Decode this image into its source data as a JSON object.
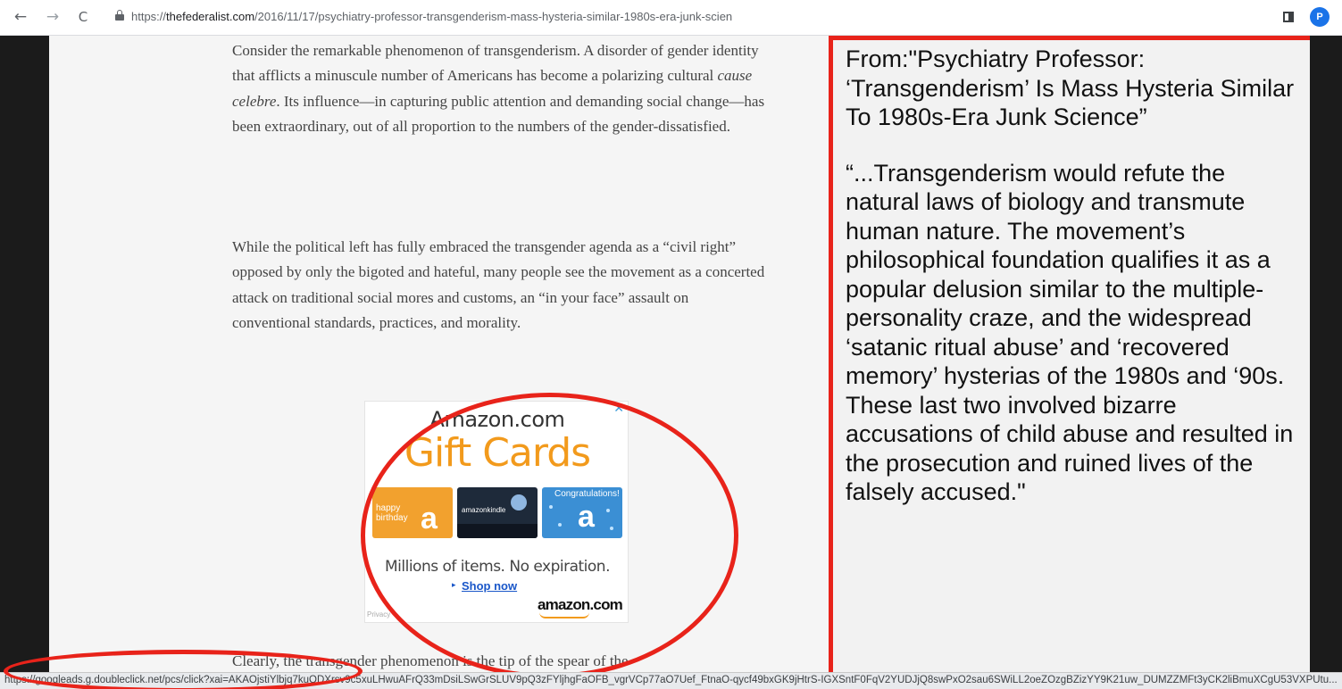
{
  "browser": {
    "back_glyph": "←",
    "forward_glyph": "→",
    "reload_glyph": "C",
    "url_scheme": "https://",
    "url_host": "thefederalist.com",
    "url_path": "/2016/11/17/psychiatry-professor-transgenderism-mass-hysteria-similar-1980s-era-junk-scien",
    "profile_initial": "P",
    "status_url": "https://googleads.g.doubleclick.net/pcs/click?xai=AKAOjstiYlbjq7kuQDXrsv9c5xuLHwuAFrQ33mDsiLSwGrSLUV9pQ3zFYljhgFaOFB_vgrVCp77aO7Uef_FtnaO-qycf49bxGK9jHtrS-IGXSntF0FqV2YUDJjQ8swPxO2sau6SWiLL2oeZOzgBZizYY9K21uw_DUMZZMFt3yCK2liBmuXCgU53VXPUtu..."
  },
  "article": {
    "paragraph1": "Consider the remarkable phenomenon of transgenderism. A disorder of gender identity that afflicts a minuscule number of Americans has become a polarizing cultural cause celebre. Its influence—in capturing public attention and demanding social change—has been extraordinary, out of all proportion to the numbers of the gender-dissatisfied.",
    "paragraph1_before_italic": "Consider the remarkable phenomenon of transgenderism. A disorder of gender identity that afflicts a minuscule number of Americans has become a polarizing cultural ",
    "paragraph1_italic": "cause celebre",
    "paragraph1_after_italic": ". Its influence—in capturing public attention and demanding social change—has been extraordinary, out of all proportion to the numbers of the gender-dissatisfied.",
    "paragraph2": "While the political left has fully embraced the transgender agenda as a “civil right” opposed by only the bigoted and hateful, many people see the movement as a concerted attack on traditional social mores and customs, an “in your face” assault on conventional standards, practices, and morality.",
    "paragraph3": "Clearly, the transgender phenomenon is the tip of the spear of the"
  },
  "ad": {
    "close_glyph": "✕",
    "brand": "Amazon.com",
    "headline": "Gift Cards",
    "card_birthday_text": "happy birthday",
    "card_letter": "a",
    "card_kindle_text": "amazonkindle",
    "card_congrats_text": "Congratulations!",
    "tagline": "Millions of items. No expiration.",
    "cta_arrow": "▸",
    "cta": "Shop now",
    "logo": "amazon.com",
    "privacy": "Privacy"
  },
  "callout": {
    "source": "From:\"Psychiatry Professor: ‘Transgenderism’ Is Mass Hysteria Similar To 1980s-Era Junk Science”",
    "quote": "“...Transgenderism would refute the natural laws of biology and transmute human nature. The movement’s philosophical foundation qualifies it as a popular delusion similar to the multiple-personality craze, and the widespread ‘satanic ritual abuse’ and ‘recovered memory’ hysterias of the 1980s and ‘90s. These last two involved bizarre accusations of child abuse and resulted in the prosecution and ruined lives of the falsely accused.\""
  },
  "colors": {
    "annotation_red": "#e8231a",
    "amazon_orange": "#f29a1c",
    "link_blue": "#1a57c9"
  },
  "icons": {
    "back": "arrow-left-icon",
    "forward": "arrow-right-icon",
    "reload": "reload-icon",
    "secure": "lock-icon",
    "side_panel": "side-panel-icon",
    "ad_close": "close-icon"
  }
}
